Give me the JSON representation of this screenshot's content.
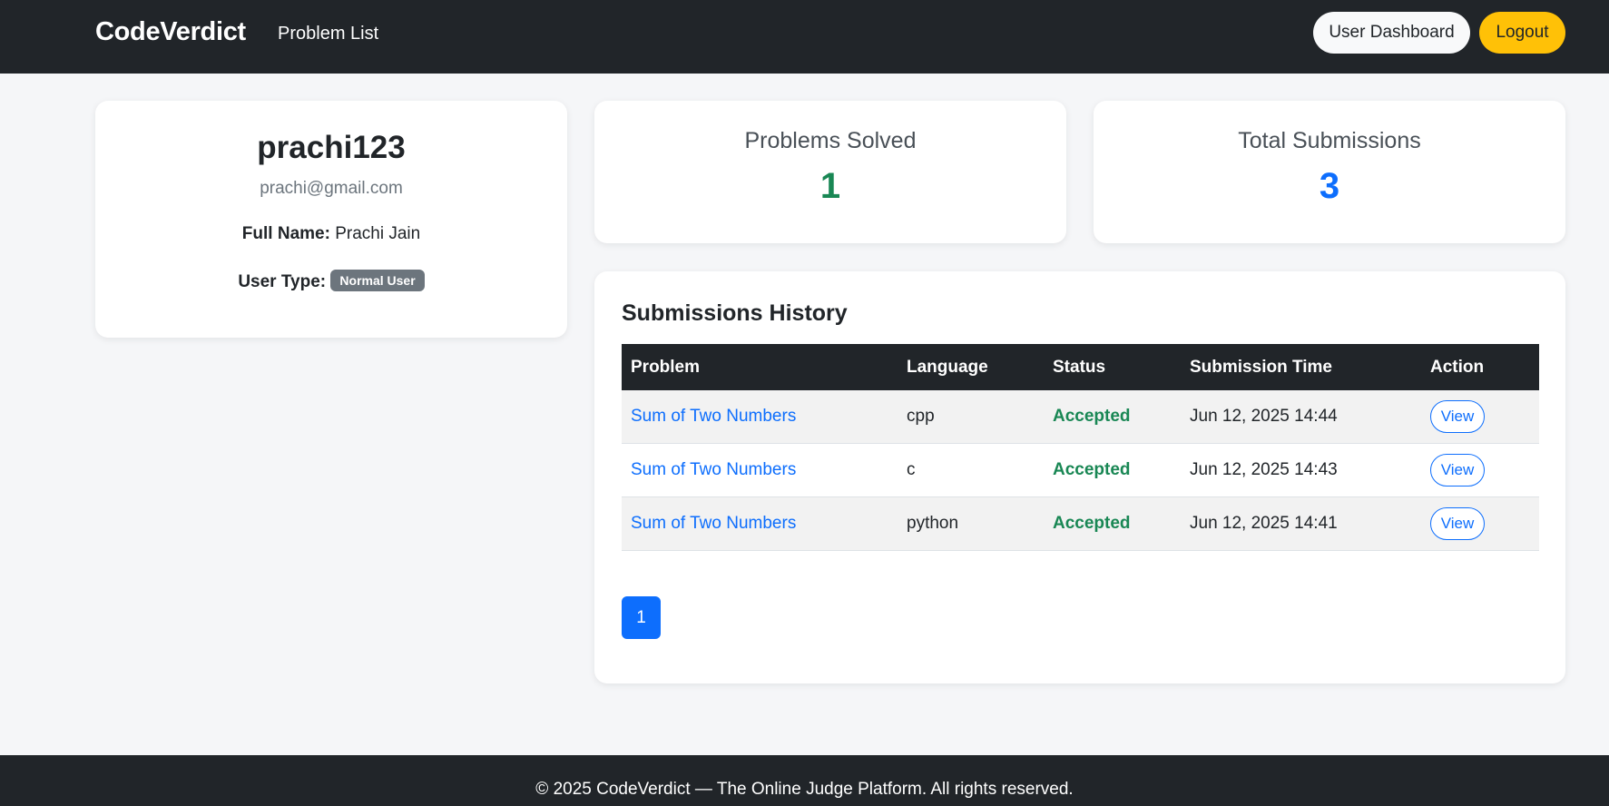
{
  "navbar": {
    "brand": "CodeVerdict",
    "problem_list_label": "Problem List",
    "dashboard_label": "User Dashboard",
    "logout_label": "Logout"
  },
  "profile": {
    "username": "prachi123",
    "email": "prachi@gmail.com",
    "full_name_label": "Full Name:",
    "full_name": "Prachi Jain",
    "user_type_label": "User Type:",
    "user_type": "Normal User"
  },
  "stats": {
    "solved_label": "Problems Solved",
    "solved_value": "1",
    "total_label": "Total Submissions",
    "total_value": "3"
  },
  "history": {
    "title": "Submissions History",
    "columns": [
      "Problem",
      "Language",
      "Status",
      "Submission Time",
      "Action"
    ],
    "rows": [
      {
        "problem": "Sum of Two Numbers",
        "language": "cpp",
        "status": "Accepted",
        "time": "Jun 12, 2025 14:44",
        "action": "View"
      },
      {
        "problem": "Sum of Two Numbers",
        "language": "c",
        "status": "Accepted",
        "time": "Jun 12, 2025 14:43",
        "action": "View"
      },
      {
        "problem": "Sum of Two Numbers",
        "language": "python",
        "status": "Accepted",
        "time": "Jun 12, 2025 14:41",
        "action": "View"
      }
    ],
    "current_page": "1"
  },
  "footer": {
    "text": "© 2025 CodeVerdict — The Online Judge Platform. All rights reserved."
  },
  "colors": {
    "navbar_bg": "#212529",
    "accent_blue": "#0d6efd",
    "success_green": "#198754",
    "warning_yellow": "#ffc107",
    "badge_gray": "#6c757d"
  }
}
